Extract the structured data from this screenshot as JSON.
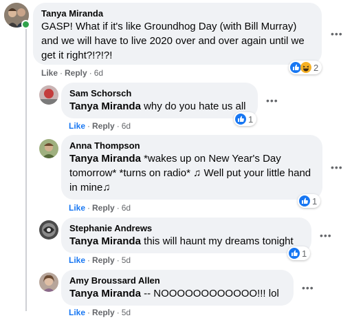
{
  "comments": [
    {
      "author": "Tanya Miranda",
      "mention": "",
      "text": "GASP! What if it's like Groundhog Day (with Bill Murray) and we will have to live 2020 over and over again until we get it right?!?!?!",
      "like": "Like",
      "reply": "Reply",
      "time": "6d",
      "reactions": "2",
      "reaction_icons": [
        "like-icon",
        "haha-icon"
      ],
      "online": true
    },
    {
      "author": "Sam Schorsch",
      "mention": "Tanya Miranda",
      "text": "why do you hate us all",
      "like": "Like",
      "reply": "Reply",
      "time": "6d",
      "reactions": "1",
      "reaction_icons": [
        "like-icon"
      ],
      "liked": true
    },
    {
      "author": "Anna Thompson",
      "mention": "Tanya Miranda",
      "text": "*wakes up on New Year's Day tomorrow* *turns on radio* ♫ Well put your little hand in mine♫",
      "like": "Like",
      "reply": "Reply",
      "time": "6d",
      "reactions": "1",
      "reaction_icons": [
        "like-icon"
      ],
      "liked": true
    },
    {
      "author": "Stephanie Andrews",
      "mention": "Tanya Miranda",
      "text": "this will haunt my dreams tonight",
      "like": "Like",
      "reply": "Reply",
      "time": "5d",
      "reactions": "1",
      "reaction_icons": [
        "like-icon"
      ],
      "liked": true
    },
    {
      "author": "Amy Broussard Allen",
      "mention": "Tanya Miranda",
      "text": "-- NOOOOOOOOOOOO!!! lol",
      "like": "Like",
      "reply": "Reply",
      "time": "5d",
      "reactions": "",
      "liked": true
    }
  ],
  "colors": {
    "bubble": "#f0f2f5",
    "meta": "#65676b",
    "like_blue": "#1877f2",
    "online": "#31a24c"
  }
}
